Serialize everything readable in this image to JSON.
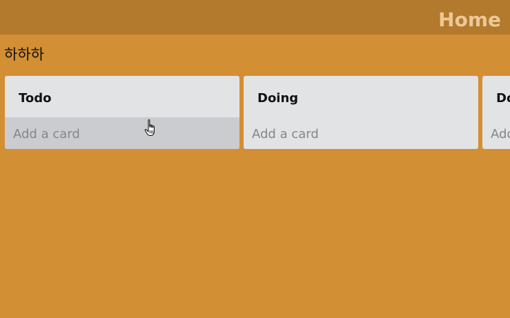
{
  "header": {
    "home_label": "Home"
  },
  "board": {
    "title": "하하하"
  },
  "lists": [
    {
      "title": "Todo",
      "add_card_label": "Add a card"
    },
    {
      "title": "Doing",
      "add_card_label": "Add a card"
    },
    {
      "title": "Done",
      "add_card_label": "Add a card"
    }
  ],
  "colors": {
    "background": "#d38f33",
    "header": "#b3792c",
    "list": "#e2e3e5",
    "list_hover": "#cbcccf"
  },
  "icons": {
    "cursor": "hand-pointer-icon"
  }
}
